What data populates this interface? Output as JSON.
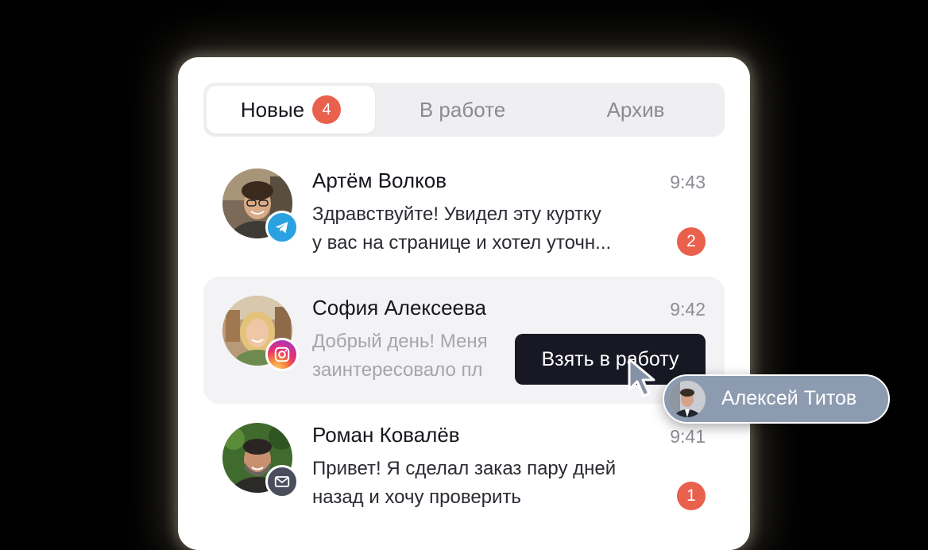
{
  "tabs": [
    {
      "label": "Новые",
      "badge": "4"
    },
    {
      "label": "В работе"
    },
    {
      "label": "Архив"
    }
  ],
  "chats": [
    {
      "name": "Артём Волков",
      "time": "9:43",
      "message_lines": [
        "Здравствуйте! Увидел эту куртку",
        "у вас на странице и хотел уточн..."
      ],
      "unread": "2",
      "source_icon": "telegram-icon"
    },
    {
      "name": "София Алексеева",
      "time": "9:42",
      "message_lines": [
        "Добрый день! Меня",
        "заинтересовало пл"
      ],
      "source_icon": "instagram-icon"
    },
    {
      "name": "Роман Ковалёв",
      "time": "9:41",
      "message_lines": [
        "Привет! Я сделал заказ пару дней",
        "назад и хочу проверить"
      ],
      "unread": "1",
      "source_icon": "mail-icon"
    }
  ],
  "action": {
    "take_label": "Взять в работу"
  },
  "assignee": {
    "name": "Алексей Титов"
  },
  "colors": {
    "accent_badge": "#e9604d",
    "action_button": "#171823",
    "assignee_chip": "#8d9bb0"
  }
}
